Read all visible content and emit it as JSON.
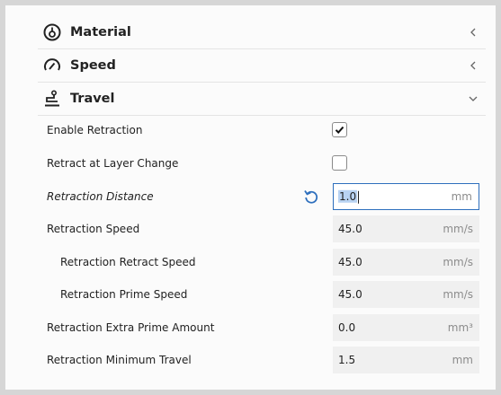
{
  "sections": [
    {
      "label": "Material",
      "icon": "material-icon",
      "state": "collapsed"
    },
    {
      "label": "Speed",
      "icon": "speedometer-icon",
      "state": "collapsed"
    },
    {
      "label": "Travel",
      "icon": "travel-icon",
      "state": "expanded"
    }
  ],
  "settings": {
    "enable_retraction": {
      "label": "Enable Retraction",
      "checked": true
    },
    "retract_layer_change": {
      "label": "Retract at Layer Change",
      "checked": false
    },
    "retraction_distance": {
      "label": "Retraction Distance",
      "value": "1.0",
      "unit": "mm"
    },
    "retraction_speed": {
      "label": "Retraction Speed",
      "value": "45.0",
      "unit": "mm/s"
    },
    "retract_speed": {
      "label": "Retraction Retract Speed",
      "value": "45.0",
      "unit": "mm/s"
    },
    "prime_speed": {
      "label": "Retraction Prime Speed",
      "value": "45.0",
      "unit": "mm/s"
    },
    "extra_prime": {
      "label": "Retraction Extra Prime Amount",
      "value": "0.0",
      "unit": "mm³"
    },
    "min_travel": {
      "label": "Retraction Minimum Travel",
      "value": "1.5",
      "unit": "mm"
    }
  },
  "colors": {
    "accent": "#2e6fbd",
    "field_bg": "#f0f0f0",
    "selection": "#b9d3f2"
  }
}
